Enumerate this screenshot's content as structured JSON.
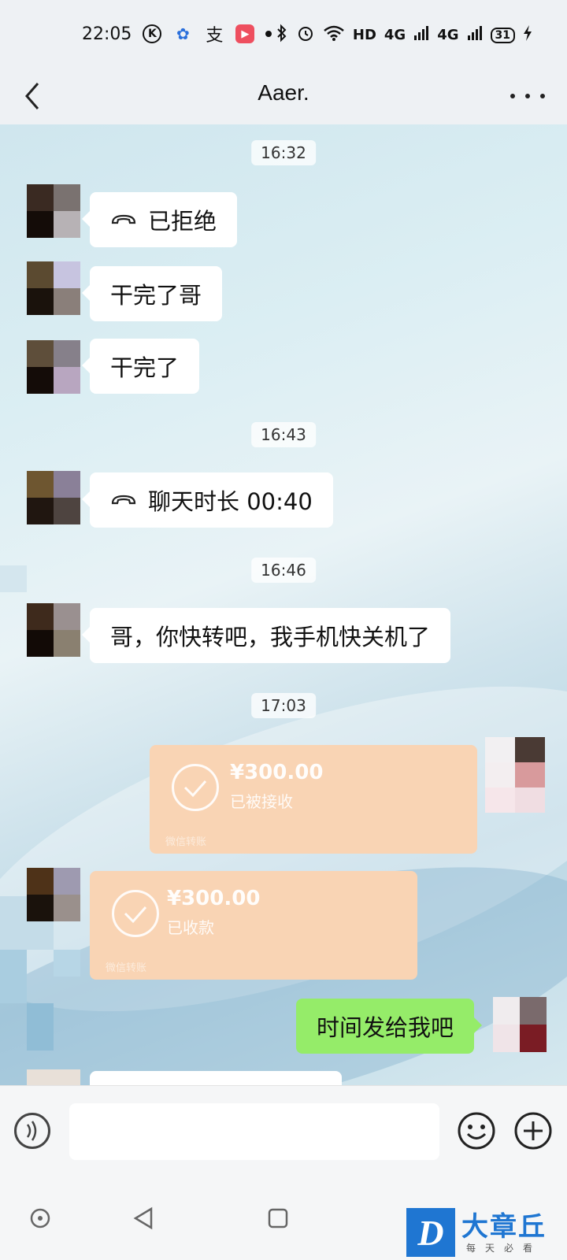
{
  "status_bar": {
    "time": "22:05",
    "app_icons": [
      "k-icon",
      "baidu-icon",
      "alipay-icon",
      "video-app-icon"
    ],
    "network": "HD",
    "signal_1": "4G",
    "signal_2": "4G",
    "battery": "31"
  },
  "header": {
    "title": "Aaer."
  },
  "messages": {
    "time_1": "16:32",
    "call_declined": "已拒绝",
    "msg_1": "干完了哥",
    "msg_2": "干完了",
    "time_2": "16:43",
    "call_duration": "聊天时长 00:40",
    "time_3": "16:46",
    "msg_3": "哥，你快转吧，我手机快关机了",
    "time_4": "17:03",
    "transfer_sent": {
      "amount": "¥300.00",
      "status": "已被接收",
      "label": "微信转账"
    },
    "transfer_received": {
      "amount": "¥300.00",
      "status": "已收款",
      "label": "微信转账"
    },
    "msg_4": "时间发给我吧"
  },
  "watermark": {
    "name": "大章丘",
    "tagline": "每天必看",
    "letter": "D"
  },
  "colors": {
    "sent_bubble": "#95ec69",
    "transfer_bg": "#f9d4b4",
    "logo_blue": "#1f76d2"
  }
}
